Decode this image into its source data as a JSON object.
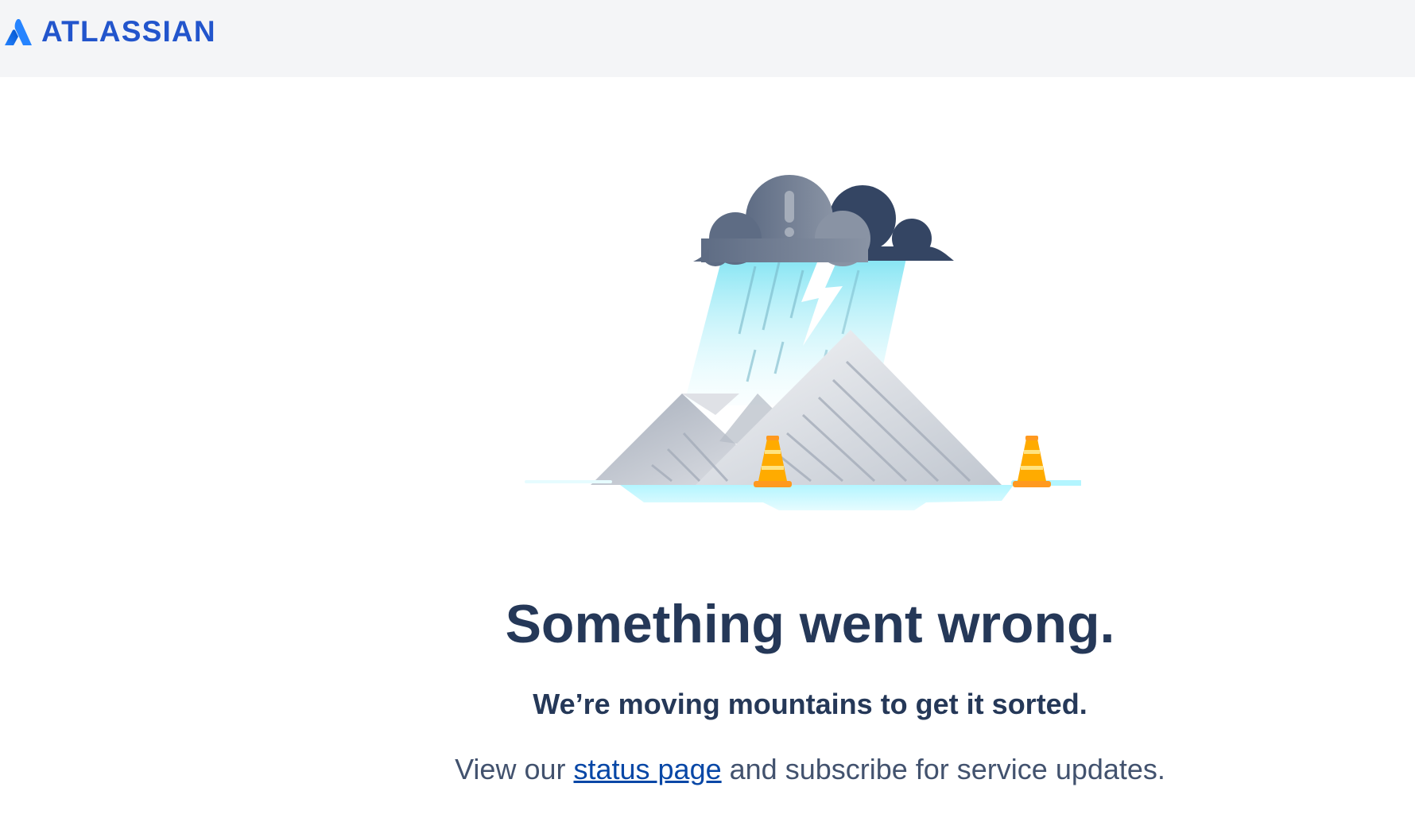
{
  "header": {
    "logo_text": "ATLASSIAN",
    "logo_icon": "atlassian-logo-icon",
    "brand_color": "#2255cc",
    "background": "#f4f5f7"
  },
  "illustration": {
    "icons": [
      "storm-cloud-icon",
      "warning-exclamation-icon",
      "lightning-bolt-icon",
      "rain-icon",
      "mountains-icon",
      "traffic-cone-icon",
      "water-puddle-icon"
    ]
  },
  "message": {
    "headline": "Something went wrong.",
    "subheadline": "We’re moving mountains to get it sorted.",
    "status_prefix": "View our ",
    "status_link_text": "status page",
    "status_suffix": " and subscribe for service updates."
  },
  "colors": {
    "heading": "#253858",
    "body_text": "#42526e",
    "link": "#0747a6"
  }
}
